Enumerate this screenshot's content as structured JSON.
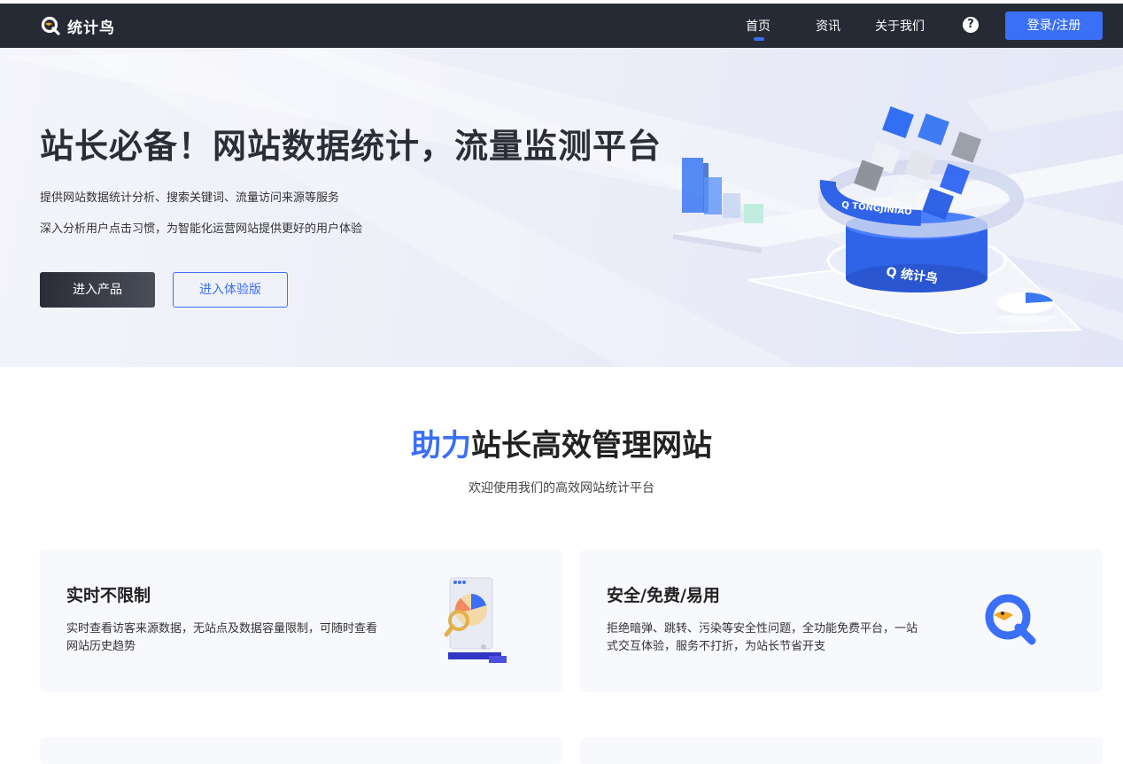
{
  "nav": {
    "brand": "统计鸟",
    "items": [
      "首页",
      "资讯",
      "关于我们"
    ],
    "help": "?",
    "login": "登录/注册"
  },
  "hero": {
    "title": "站长必备！网站数据统计，流量监测平台",
    "subtitle1": "提供网站数据统计分析、搜索关键词、流量访问来源等服务",
    "subtitle2": "深入分析用户点击习惯，为智能化运营网站提供更好的用户体验",
    "primary_button": "进入产品",
    "secondary_button": "进入体验版",
    "ring_label": "TONGJINIAO",
    "base_label": "统计鸟"
  },
  "section": {
    "title_accent": "助力",
    "title_rest": "站长高效管理网站",
    "subtitle": "欢迎使用我们的高效网站统计平台"
  },
  "features": [
    {
      "title": "实时不限制",
      "desc": "实时查看访客来源数据，无站点及数据容量限制，可随时查看网站历史趋势",
      "icon": "report-magnifier-icon"
    },
    {
      "title": "安全/免费/易用",
      "desc": "拒绝暗弹、跳转、污染等安全性问题，全功能免费平台，一站式交互体验，服务不打折，为站长节省开支",
      "icon": "bird-logo-icon"
    }
  ],
  "colors": {
    "nav_bg": "#262a35",
    "accent": "#3a6ff7"
  }
}
